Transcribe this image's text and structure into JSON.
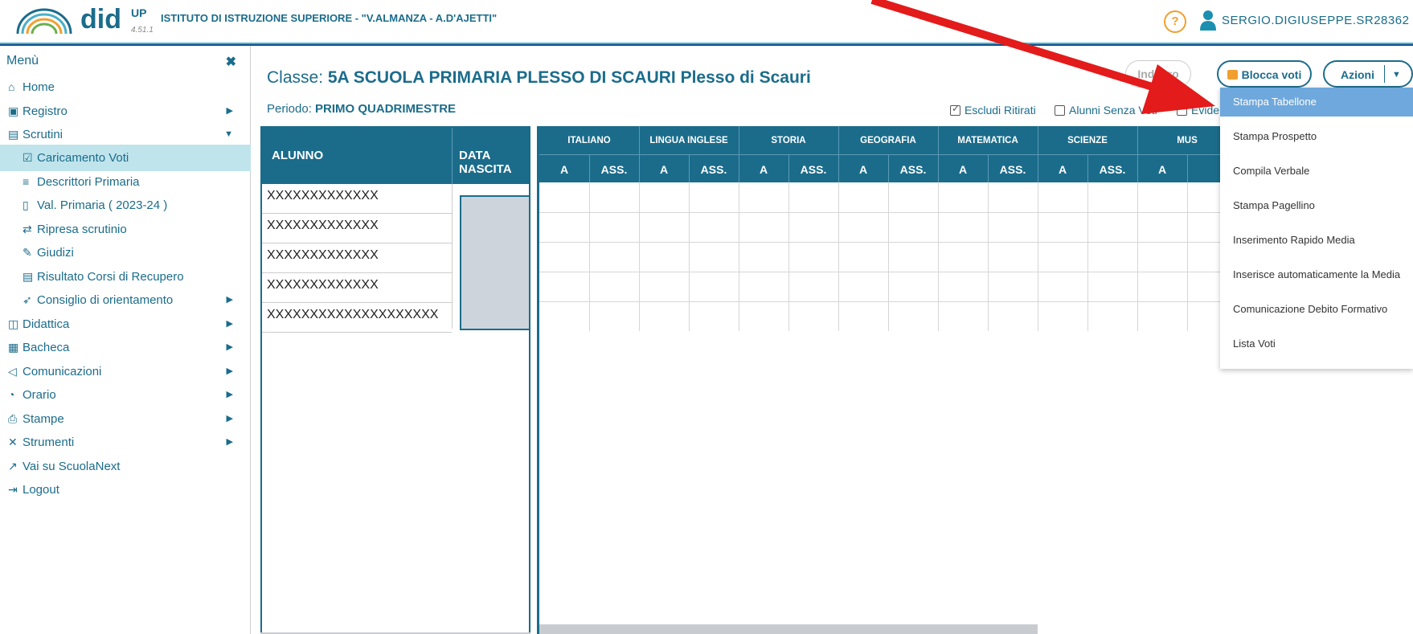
{
  "header": {
    "logo_text": "did",
    "logo_up": "UP",
    "version": "4.51.1",
    "school": "ISTITUTO DI ISTRUZIONE SUPERIORE - \"V.ALMANZA - A.D'AJETTI\"",
    "help": "?",
    "user": "SERGIO.DIGIUSEPPE.SR28362"
  },
  "sidebar": {
    "title": "Menù",
    "close": "✖",
    "items": [
      {
        "label": "Home",
        "icon": "home-icon"
      },
      {
        "label": "Registro",
        "icon": "calendar-icon"
      },
      {
        "label": "Scrutini",
        "icon": "document-icon"
      },
      {
        "label": "Caricamento Voti",
        "icon": "checkbox-icon"
      },
      {
        "label": "Descrittori Primaria",
        "icon": "lines-icon"
      },
      {
        "label": "Val. Primaria ( 2023-24 )",
        "icon": "page-icon"
      },
      {
        "label": "Ripresa scrutinio",
        "icon": "refresh-icon"
      },
      {
        "label": "Giudizi",
        "icon": "edit-icon"
      },
      {
        "label": "Risultato Corsi di Recupero",
        "icon": "document-icon"
      },
      {
        "label": "Consiglio di orientamento",
        "icon": "rocket-icon"
      },
      {
        "label": "Didattica",
        "icon": "book-icon"
      },
      {
        "label": "Bacheca",
        "icon": "board-icon"
      },
      {
        "label": "Comunicazioni",
        "icon": "send-icon"
      },
      {
        "label": "Orario",
        "icon": "clock-icon"
      },
      {
        "label": "Stampe",
        "icon": "printer-icon"
      },
      {
        "label": "Strumenti",
        "icon": "tools-icon"
      },
      {
        "label": "Vai su ScuolaNext",
        "icon": "external-icon"
      },
      {
        "label": "Logout",
        "icon": "logout-icon"
      }
    ]
  },
  "main": {
    "classe_label": "Classe: ",
    "classe_value": "5A SCUOLA PRIMARIA PLESSO DI SCAURI Plesso di Scauri",
    "periodo_label": "Periodo: ",
    "periodo_value": "PRIMO QUADRIMESTRE",
    "buttons": {
      "indietro": "Indietro",
      "blocca": "Blocca voti",
      "azioni": "Azioni"
    },
    "options": {
      "escludi": "Escludi Ritirati",
      "senza_voti": "Alunni Senza Voti",
      "evide": "Evide"
    },
    "table": {
      "col_alunno": "ALUNNO",
      "col_data": "DATA NASCITA",
      "subjects": [
        "ITALIANO",
        "LINGUA INGLESE",
        "STORIA",
        "GEOGRAFIA",
        "MATEMATICA",
        "SCIENZE",
        "MUS"
      ],
      "sub_a": "A",
      "sub_ass": "ASS.",
      "students": [
        "XXXXXXXXXXXXX",
        "XXXXXXXXXXXXX",
        "XXXXXXXXXXXXX",
        "XXXXXXXXXXXXX",
        "XXXXXXXXXXXXXXXXXXXX"
      ]
    }
  },
  "dropdown": {
    "items": [
      "Stampa Tabellone",
      "Stampa Prospetto",
      "Compila Verbale",
      "Stampa Pagellino",
      "Inserimento Rapido Media",
      "Inserisce automaticamente la Media",
      "Comunicazione Debito Formativo",
      "Lista Voti"
    ]
  },
  "colors": {
    "primary": "#1b6c8b",
    "accent": "#f0a030",
    "highlight": "#6fa8dc",
    "arrow": "#e31b1b"
  }
}
